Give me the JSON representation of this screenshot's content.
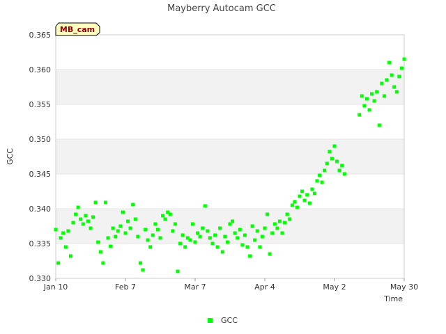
{
  "chart_data": {
    "type": "scatter",
    "title": "Mayberry Autocam GCC",
    "xlabel": "Time",
    "ylabel": "GCC",
    "site_badge": "MB_cam",
    "xlim": [
      "2019-01-10",
      "2019-05-30"
    ],
    "ylim": [
      0.33,
      0.365
    ],
    "x_ticks": [
      "Jan 10",
      "Feb 7",
      "Mar 7",
      "Apr 4",
      "May 2",
      "May 30"
    ],
    "y_ticks": [
      "0.330",
      "0.335",
      "0.340",
      "0.345",
      "0.350",
      "0.355",
      "0.360",
      "0.365"
    ],
    "grid": "horizontal alternating bands",
    "legend_position": "bottom-center",
    "colors": {
      "series": "#00ff00",
      "band": "#f2f2f2",
      "axis": "#cccccc"
    },
    "series": [
      {
        "name": "GCC",
        "points": [
          [
            "2019-01-10",
            0.337
          ],
          [
            "2019-01-11",
            0.3322
          ],
          [
            "2019-01-12",
            0.3358
          ],
          [
            "2019-01-13",
            0.3365
          ],
          [
            "2019-01-14",
            0.3345
          ],
          [
            "2019-01-15",
            0.3368
          ],
          [
            "2019-01-16",
            0.3332
          ],
          [
            "2019-01-17",
            0.338
          ],
          [
            "2019-01-18",
            0.3392
          ],
          [
            "2019-01-19",
            0.3402
          ],
          [
            "2019-01-20",
            0.3385
          ],
          [
            "2019-01-21",
            0.3378
          ],
          [
            "2019-01-22",
            0.339
          ],
          [
            "2019-01-23",
            0.3382
          ],
          [
            "2019-01-24",
            0.3372
          ],
          [
            "2019-01-25",
            0.3388
          ],
          [
            "2019-01-26",
            0.3409
          ],
          [
            "2019-01-27",
            0.3352
          ],
          [
            "2019-01-28",
            0.3338
          ],
          [
            "2019-01-29",
            0.3322
          ],
          [
            "2019-01-30",
            0.3409
          ],
          [
            "2019-01-31",
            0.3358
          ],
          [
            "2019-02-01",
            0.3346
          ],
          [
            "2019-02-02",
            0.3372
          ],
          [
            "2019-02-03",
            0.336
          ],
          [
            "2019-02-04",
            0.3368
          ],
          [
            "2019-02-05",
            0.3375
          ],
          [
            "2019-02-06",
            0.3395
          ],
          [
            "2019-02-07",
            0.3365
          ],
          [
            "2019-02-08",
            0.3382
          ],
          [
            "2019-02-09",
            0.3372
          ],
          [
            "2019-02-10",
            0.3406
          ],
          [
            "2019-02-11",
            0.3385
          ],
          [
            "2019-02-12",
            0.336
          ],
          [
            "2019-02-13",
            0.3322
          ],
          [
            "2019-02-14",
            0.3312
          ],
          [
            "2019-02-15",
            0.337
          ],
          [
            "2019-02-16",
            0.3355
          ],
          [
            "2019-02-17",
            0.3345
          ],
          [
            "2019-02-18",
            0.3362
          ],
          [
            "2019-02-19",
            0.3378
          ],
          [
            "2019-02-20",
            0.337
          ],
          [
            "2019-02-21",
            0.3358
          ],
          [
            "2019-02-22",
            0.339
          ],
          [
            "2019-02-23",
            0.3385
          ],
          [
            "2019-02-24",
            0.3395
          ],
          [
            "2019-02-25",
            0.3392
          ],
          [
            "2019-02-26",
            0.3368
          ],
          [
            "2019-02-27",
            0.3378
          ],
          [
            "2019-02-28",
            0.331
          ],
          [
            "2019-03-01",
            0.335
          ],
          [
            "2019-03-02",
            0.3362
          ],
          [
            "2019-03-03",
            0.3345
          ],
          [
            "2019-03-04",
            0.3358
          ],
          [
            "2019-03-05",
            0.3355
          ],
          [
            "2019-03-06",
            0.3378
          ],
          [
            "2019-03-07",
            0.3352
          ],
          [
            "2019-03-08",
            0.3365
          ],
          [
            "2019-03-09",
            0.336
          ],
          [
            "2019-03-10",
            0.3372
          ],
          [
            "2019-03-11",
            0.3404
          ],
          [
            "2019-03-12",
            0.3368
          ],
          [
            "2019-03-13",
            0.3358
          ],
          [
            "2019-03-14",
            0.335
          ],
          [
            "2019-03-15",
            0.3362
          ],
          [
            "2019-03-16",
            0.3345
          ],
          [
            "2019-03-17",
            0.3372
          ],
          [
            "2019-03-18",
            0.3338
          ],
          [
            "2019-03-19",
            0.336
          ],
          [
            "2019-03-20",
            0.3352
          ],
          [
            "2019-03-21",
            0.3378
          ],
          [
            "2019-03-22",
            0.3382
          ],
          [
            "2019-03-23",
            0.3365
          ],
          [
            "2019-03-24",
            0.3358
          ],
          [
            "2019-03-25",
            0.337
          ],
          [
            "2019-03-26",
            0.3348
          ],
          [
            "2019-03-27",
            0.3362
          ],
          [
            "2019-03-28",
            0.3345
          ],
          [
            "2019-03-29",
            0.3332
          ],
          [
            "2019-03-30",
            0.3375
          ],
          [
            "2019-03-31",
            0.3355
          ],
          [
            "2019-04-01",
            0.3368
          ],
          [
            "2019-04-02",
            0.3345
          ],
          [
            "2019-04-03",
            0.336
          ],
          [
            "2019-04-04",
            0.3372
          ],
          [
            "2019-04-05",
            0.3392
          ],
          [
            "2019-04-06",
            0.3335
          ],
          [
            "2019-04-07",
            0.3365
          ],
          [
            "2019-04-08",
            0.3378
          ],
          [
            "2019-04-09",
            0.3372
          ],
          [
            "2019-04-10",
            0.3382
          ],
          [
            "2019-04-11",
            0.3365
          ],
          [
            "2019-04-12",
            0.338
          ],
          [
            "2019-04-13",
            0.3392
          ],
          [
            "2019-04-14",
            0.3385
          ],
          [
            "2019-04-15",
            0.3405
          ],
          [
            "2019-04-16",
            0.341
          ],
          [
            "2019-04-17",
            0.3402
          ],
          [
            "2019-04-18",
            0.3418
          ],
          [
            "2019-04-19",
            0.3425
          ],
          [
            "2019-04-20",
            0.3412
          ],
          [
            "2019-04-21",
            0.342
          ],
          [
            "2019-04-22",
            0.3408
          ],
          [
            "2019-04-23",
            0.3428
          ],
          [
            "2019-04-24",
            0.3422
          ],
          [
            "2019-04-25",
            0.344
          ],
          [
            "2019-04-26",
            0.3448
          ],
          [
            "2019-04-27",
            0.3438
          ],
          [
            "2019-04-28",
            0.3455
          ],
          [
            "2019-04-29",
            0.3465
          ],
          [
            "2019-04-30",
            0.3482
          ],
          [
            "2019-05-01",
            0.3472
          ],
          [
            "2019-05-02",
            0.349
          ],
          [
            "2019-05-03",
            0.3468
          ],
          [
            "2019-05-04",
            0.3455
          ],
          [
            "2019-05-05",
            0.3462
          ],
          [
            "2019-05-06",
            0.345
          ],
          [
            "2019-05-12",
            0.3535
          ],
          [
            "2019-05-13",
            0.3562
          ],
          [
            "2019-05-14",
            0.3548
          ],
          [
            "2019-05-15",
            0.3558
          ],
          [
            "2019-05-16",
            0.3542
          ],
          [
            "2019-05-17",
            0.3565
          ],
          [
            "2019-05-18",
            0.3555
          ],
          [
            "2019-05-19",
            0.3568
          ],
          [
            "2019-05-20",
            0.352
          ],
          [
            "2019-05-21",
            0.358
          ],
          [
            "2019-05-22",
            0.3562
          ],
          [
            "2019-05-23",
            0.3585
          ],
          [
            "2019-05-24",
            0.361
          ],
          [
            "2019-05-25",
            0.3592
          ],
          [
            "2019-05-26",
            0.3575
          ],
          [
            "2019-05-27",
            0.3568
          ],
          [
            "2019-05-28",
            0.359
          ],
          [
            "2019-05-29",
            0.3602
          ],
          [
            "2019-05-30",
            0.3615
          ]
        ]
      }
    ]
  },
  "legend": {
    "label": "GCC"
  }
}
